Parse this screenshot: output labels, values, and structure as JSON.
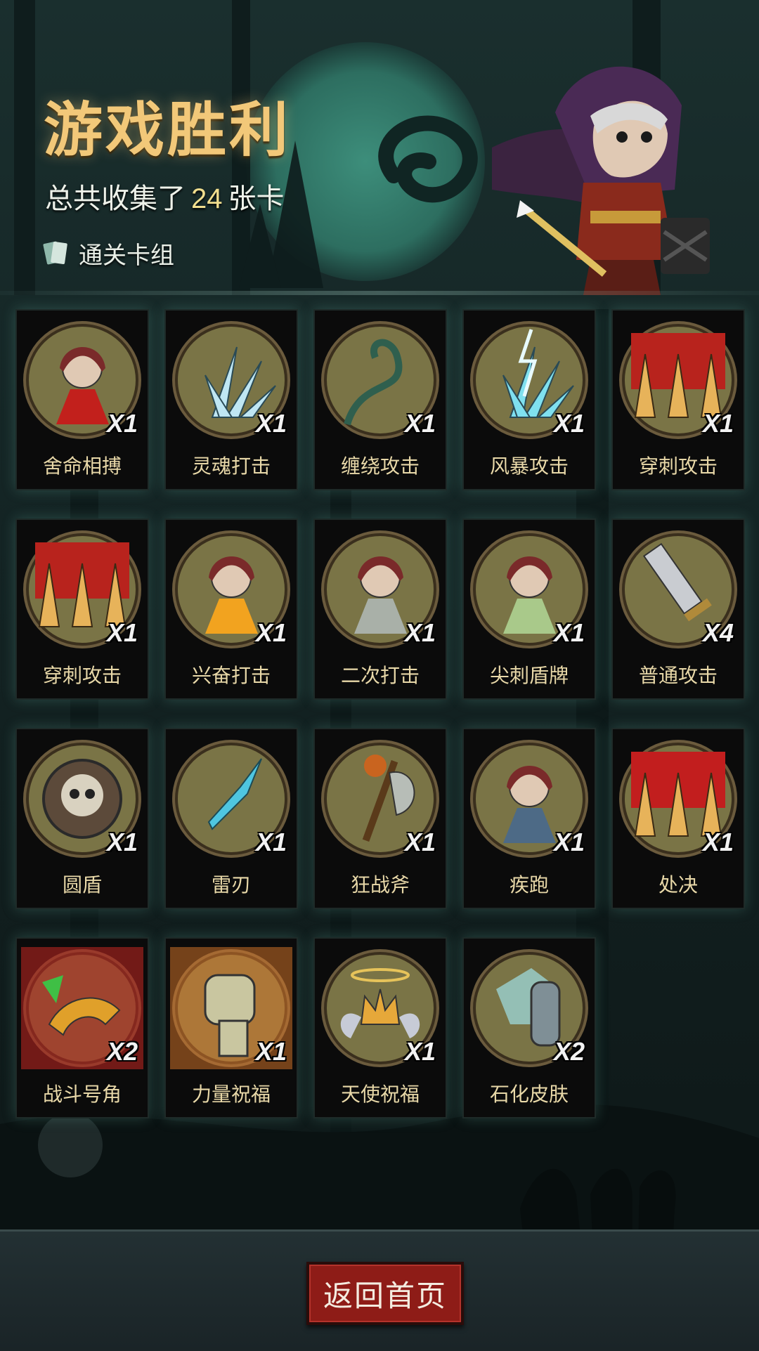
{
  "header": {
    "title": "游戏胜利",
    "subtitle_prefix": "总共收集了",
    "card_count": "24",
    "subtitle_suffix": "张卡",
    "deck_label": "通关卡组"
  },
  "cards": [
    {
      "name": "舍命相搏",
      "qty": "X1",
      "icon": "hooded-fighter-icon",
      "accent": "#c2201c"
    },
    {
      "name": "灵魂打击",
      "qty": "X1",
      "icon": "ice-shards-icon",
      "accent": "#bfe6f3"
    },
    {
      "name": "缠绕攻击",
      "qty": "X1",
      "icon": "thorn-vine-icon",
      "accent": "#2f5f4e"
    },
    {
      "name": "风暴攻击",
      "qty": "X1",
      "icon": "lightning-storm-icon",
      "accent": "#7fe0ef"
    },
    {
      "name": "穿刺攻击",
      "qty": "X1",
      "icon": "ground-spikes-icon",
      "accent": "#b8231d"
    },
    {
      "name": "穿刺攻击",
      "qty": "X1",
      "icon": "ground-spikes-icon",
      "accent": "#b8231d"
    },
    {
      "name": "兴奋打击",
      "qty": "X1",
      "icon": "fiery-hero-icon",
      "accent": "#f2a31f"
    },
    {
      "name": "二次打击",
      "qty": "X1",
      "icon": "double-dagger-icon",
      "accent": "#a9b0a8"
    },
    {
      "name": "尖刺盾牌",
      "qty": "X1",
      "icon": "spiked-shield-icon",
      "accent": "#a9c98a"
    },
    {
      "name": "普通攻击",
      "qty": "X4",
      "icon": "sword-icon",
      "accent": "#c9ccd1"
    },
    {
      "name": "圆盾",
      "qty": "X1",
      "icon": "skull-shield-icon",
      "accent": "#d9d2c0"
    },
    {
      "name": "雷刃",
      "qty": "X1",
      "icon": "crystal-blade-icon",
      "accent": "#4fc6e0"
    },
    {
      "name": "狂战斧",
      "qty": "X1",
      "icon": "battle-axe-icon",
      "accent": "#b7bdb7"
    },
    {
      "name": "疾跑",
      "qty": "X1",
      "icon": "running-wolf-icon",
      "accent": "#4d6a86"
    },
    {
      "name": "处决",
      "qty": "X1",
      "icon": "execution-icon",
      "accent": "#c21e1e"
    },
    {
      "name": "战斗号角",
      "qty": "X2",
      "icon": "war-horn-icon",
      "accent": "#e0a02a"
    },
    {
      "name": "力量祝福",
      "qty": "X1",
      "icon": "fist-icon",
      "accent": "#e07a2a"
    },
    {
      "name": "天使祝福",
      "qty": "X1",
      "icon": "winged-crown-icon",
      "accent": "#e6a83a"
    },
    {
      "name": "石化皮肤",
      "qty": "X2",
      "icon": "stone-arm-icon",
      "accent": "#7f8f96"
    }
  ],
  "footer": {
    "home_button": "返回首页"
  }
}
